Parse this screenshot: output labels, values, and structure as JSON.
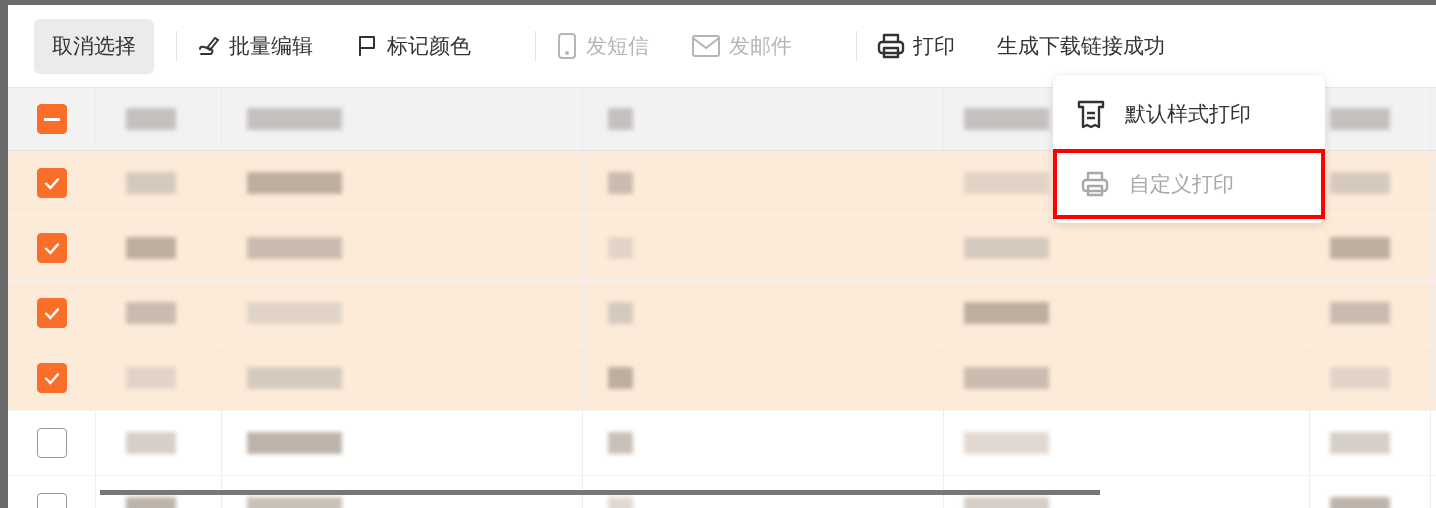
{
  "toolbar": {
    "items": [
      {
        "kind": "button",
        "label": "取消选择"
      },
      {
        "kind": "divider"
      },
      {
        "kind": "edit",
        "label": "批量编辑",
        "disabled": false
      },
      {
        "kind": "flag",
        "label": "标记颜色",
        "disabled": false
      },
      {
        "kind": "divider"
      },
      {
        "kind": "sms",
        "label": "发短信",
        "disabled": true
      },
      {
        "kind": "email",
        "label": "发邮件",
        "disabled": true
      },
      {
        "kind": "divider"
      },
      {
        "kind": "print",
        "label": "打印",
        "disabled": false
      },
      {
        "kind": "text",
        "label": "生成下载链接成功",
        "disabled": false
      }
    ]
  },
  "print_menu": {
    "items": [
      {
        "kind": "default",
        "label": "默认样式打印",
        "disabled": false,
        "highlighted": false
      },
      {
        "kind": "custom",
        "label": "自定义打印",
        "disabled": true,
        "highlighted": true
      }
    ]
  },
  "table": {
    "select_all": {
      "checked": true,
      "partial": true
    },
    "rows": [
      {
        "checked": true
      },
      {
        "checked": true
      },
      {
        "checked": true
      },
      {
        "checked": true
      },
      {
        "checked": false
      },
      {
        "checked": false
      }
    ]
  }
}
